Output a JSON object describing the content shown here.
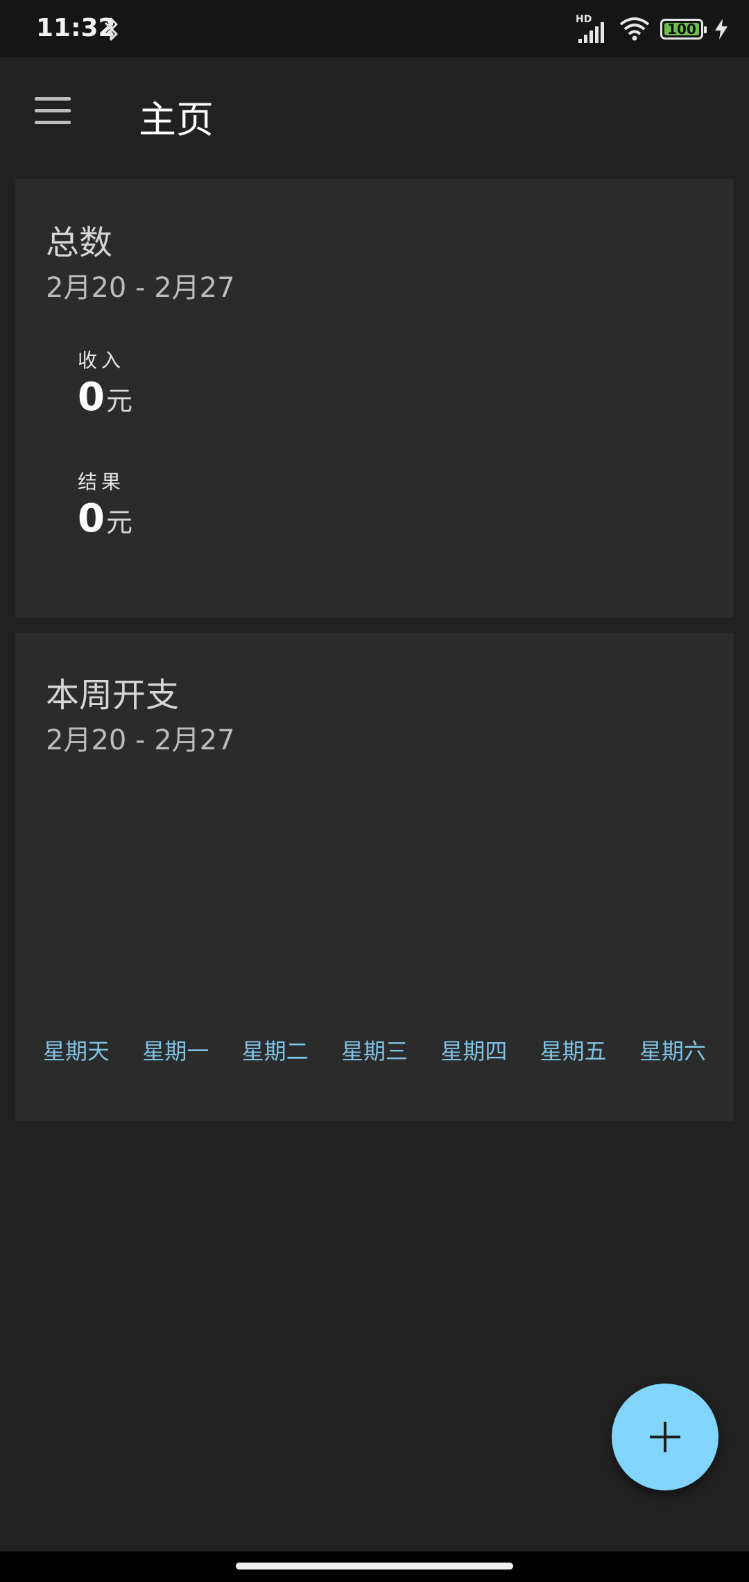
{
  "status_bar": {
    "time": "11:32",
    "network_label": "HD",
    "battery_level": "100",
    "battery_percent": 100,
    "icons": [
      "bluetooth-icon",
      "signal-icon",
      "wifi-icon",
      "battery-icon",
      "charging-icon"
    ]
  },
  "app_bar": {
    "title": "主页",
    "menu_icon": "hamburger-menu-icon"
  },
  "summary_card": {
    "title": "总数",
    "date_range": "2月20 - 2月27",
    "income": {
      "label": "收入",
      "value": "0",
      "unit": "元"
    },
    "result": {
      "label": "结果",
      "value": "0",
      "unit": "元"
    }
  },
  "weekly_card": {
    "title": "本周开支",
    "date_range": "2月20 - 2月27",
    "weekdays": [
      "星期天",
      "星期一",
      "星期二",
      "星期三",
      "星期四",
      "星期五",
      "星期六"
    ]
  },
  "fab": {
    "icon": "plus-icon"
  },
  "colors": {
    "background": "#212121",
    "card": "#2b2b2b",
    "accent": "#81d4fa",
    "weekday_text": "#7fc3e6"
  }
}
